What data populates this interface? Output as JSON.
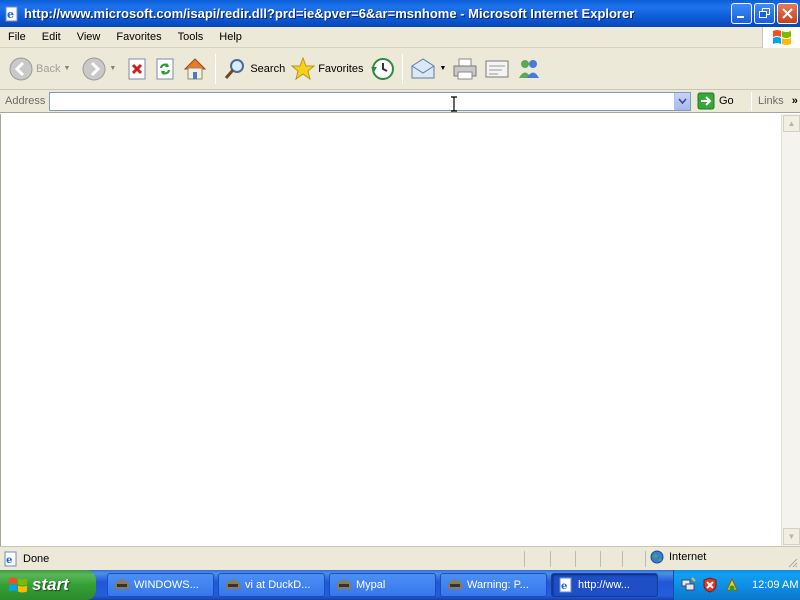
{
  "window": {
    "title": "http://www.microsoft.com/isapi/redir.dll?prd=ie&pver=6&ar=msnhome - Microsoft Internet Explorer",
    "app_icon": "ie-page-icon",
    "buttons": [
      "minimize-icon",
      "maximize-icon",
      "close-icon"
    ]
  },
  "menu": {
    "items": [
      "File",
      "Edit",
      "View",
      "Favorites",
      "Tools",
      "Help"
    ],
    "logo": "windows-flag-logo"
  },
  "toolbar": {
    "back_label": "Back",
    "search_label": "Search",
    "favorites_label": "Favorites",
    "icons": [
      "back-icon",
      "forward-icon",
      "stop-icon",
      "refresh-icon",
      "home-icon",
      "search-icon",
      "favorites-icon",
      "history-icon",
      "mail-icon",
      "print-icon",
      "edit-icon",
      "messenger-icon"
    ]
  },
  "address": {
    "label": "Address",
    "value": "",
    "go_label": "Go",
    "links_label": "Links"
  },
  "status": {
    "text": "Done",
    "zone_label": "Internet"
  },
  "taskbar": {
    "start_label": "start",
    "tasks": [
      {
        "label": "WINDOWS...",
        "active": false
      },
      {
        "label": "vi at DuckD...",
        "active": false
      },
      {
        "label": "Mypal",
        "active": false
      },
      {
        "label": "Warning: P...",
        "active": false
      },
      {
        "label": "http://ww...",
        "active": true
      }
    ],
    "clock": "12:09 AM"
  },
  "colors": {
    "titlebar": "#0a58d2",
    "chrome": "#ece9d8",
    "taskbar": "#245edb",
    "start": "#35a035"
  }
}
